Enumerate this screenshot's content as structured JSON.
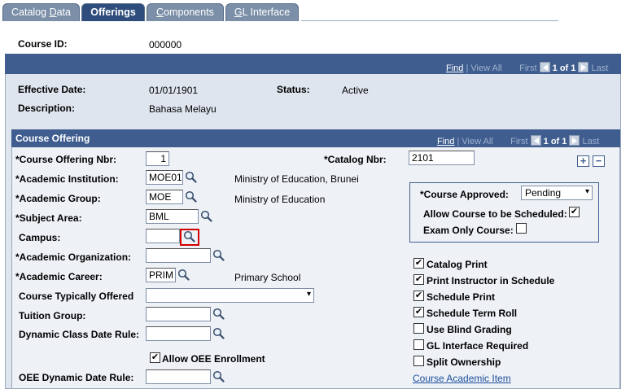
{
  "tabs": [
    {
      "prefix": "Catalog ",
      "accel": "D",
      "rest": "ata"
    },
    {
      "label": "Offerings"
    },
    {
      "prefix": "",
      "accel": "C",
      "rest": "omponents"
    },
    {
      "prefix": "",
      "accel": "G",
      "rest": "L Interface"
    }
  ],
  "header": {
    "course_id_label": "Course ID:",
    "course_id": "000000"
  },
  "effdt_nav": {
    "find": "Find",
    "sep": "|",
    "view_all": "View All",
    "first": "First",
    "count": "1 of 1",
    "last": "Last"
  },
  "effdt": {
    "effective_date_label": "Effective Date:",
    "effective_date": "01/01/1901",
    "status_label": "Status:",
    "status": "Active",
    "description_label": "Description:",
    "description": "Bahasa Melayu"
  },
  "offering_nav": {
    "title": "Course Offering",
    "find": "Find",
    "sep": "|",
    "view_all": "View All",
    "first": "First",
    "count": "1 of 1",
    "last": "Last",
    "add": "+",
    "remove": "−"
  },
  "offering": {
    "offering_nbr_label": "*Course Offering Nbr:",
    "offering_nbr": "1",
    "catalog_nbr_label": "*Catalog Nbr:",
    "catalog_nbr": "2101",
    "institution_label": "*Academic Institution:",
    "institution": "MOE01",
    "institution_desc": "Ministry of Education, Brunei",
    "group_label": "*Academic Group:",
    "group": "MOE",
    "group_desc": "Ministry of Education",
    "subject_label": "*Subject Area:",
    "subject": "BML",
    "campus_label": "Campus:",
    "campus": "",
    "organization_label": "*Academic Organization:",
    "organization": "",
    "career_label": "*Academic Career:",
    "career": "PRIM",
    "career_desc": "Primary School",
    "typically_offered_label": "Course Typically Offered",
    "typically_offered": "",
    "tuition_group_label": "Tuition Group:",
    "tuition_group": "",
    "dyn_class_rule_label": "Dynamic Class Date Rule:",
    "dyn_class_rule": "",
    "allow_oee_label": "Allow OEE Enrollment",
    "allow_oee": true,
    "oee_rule_label": "OEE Dynamic Date Rule:",
    "oee_rule": ""
  },
  "approval": {
    "approved_label": "*Course Approved:",
    "approved": "Pending",
    "allow_schedule_label": "Allow Course to be Scheduled:",
    "allow_schedule": true,
    "exam_only_label": "Exam Only Course:",
    "exam_only": false
  },
  "flags": [
    {
      "label": "Catalog Print",
      "checked": true
    },
    {
      "label": "Print Instructor in Schedule",
      "checked": true
    },
    {
      "label": "Schedule Print",
      "checked": true
    },
    {
      "label": "Schedule Term Roll",
      "checked": true
    },
    {
      "label": "Use Blind Grading",
      "checked": false
    },
    {
      "label": "GL Interface Required",
      "checked": false
    },
    {
      "label": "Split Ownership",
      "checked": false
    }
  ],
  "academic_item_link": "Course Academic Item",
  "icons": {
    "lookup": "magnifier-icon",
    "check": "checkmark-icon",
    "dropdown": "chevron-down-icon",
    "prev": "arrow-left-icon",
    "next": "arrow-right-icon"
  },
  "colors": {
    "header_bar": "#3f5d8f",
    "panel_bg": "#dfe5ef",
    "inner_bg": "#eef1f6",
    "link": "#1c4f9c",
    "highlight": "#d40000"
  }
}
